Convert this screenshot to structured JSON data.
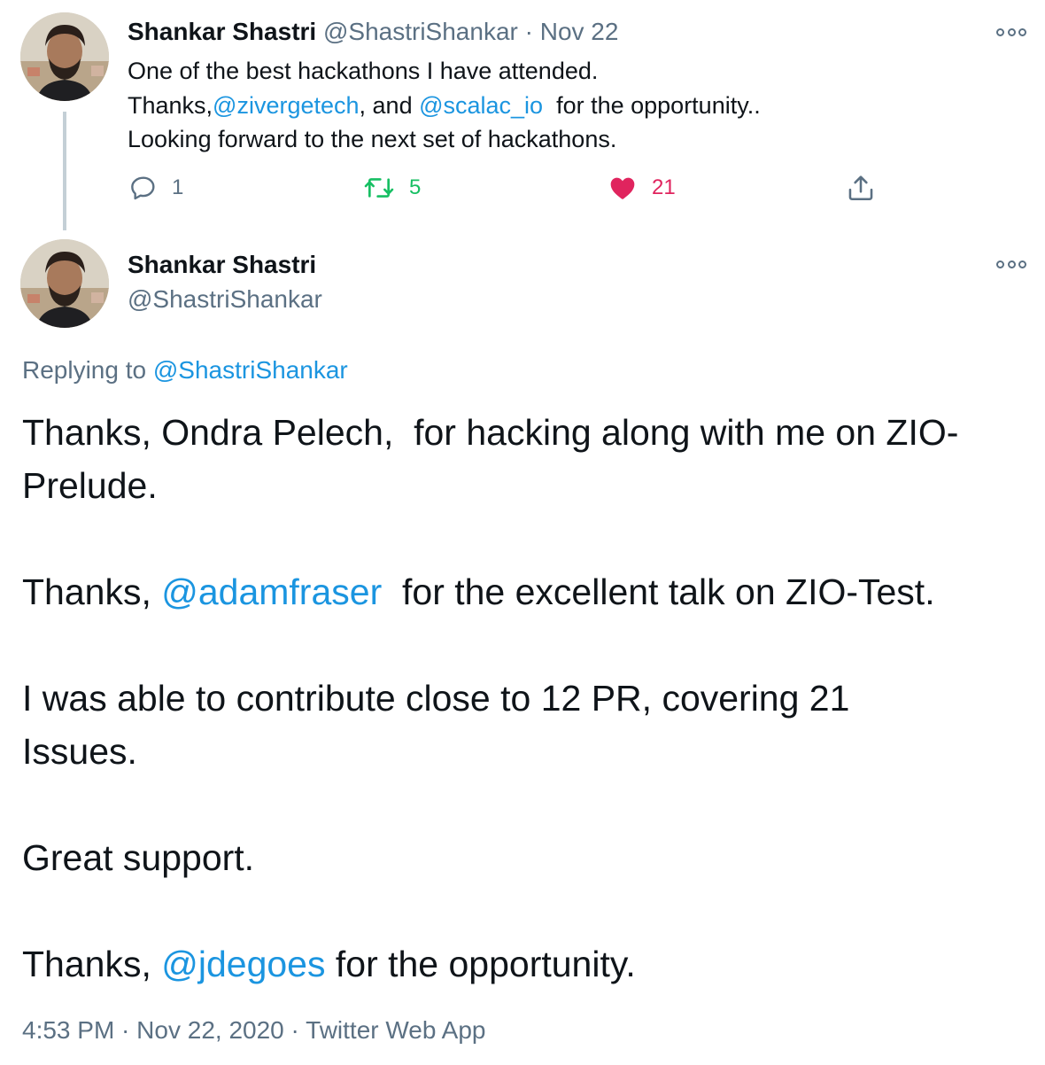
{
  "tweet1": {
    "author_name": "Shankar Shastri",
    "author_handle": "@ShastriShankar",
    "separator": "·",
    "date": "Nov 22",
    "more_icon": "more-options-icon",
    "body": {
      "line1": "One of the best hackathons I have attended.",
      "line2_prefix": "Thanks,",
      "mention_ziverge": "@zivergetech",
      "line2_mid": ", and ",
      "mention_scalac": "@scalac_io",
      "line2_suffix": "  for the opportunity..",
      "line3": "Looking forward to the next set of hackathons."
    },
    "actions": {
      "reply_count": "1",
      "retweet_count": "5",
      "like_count": "21"
    }
  },
  "tweet2": {
    "author_name": "Shankar Shastri",
    "author_handle": "@ShastriShankar",
    "replying_prefix": "Replying to ",
    "replying_handle": "@ShastriShankar",
    "body": {
      "p1_line1": "Thanks, Ondra Pelech,  for hacking along with me on ZIO-",
      "p1_line2": "Prelude.",
      "p2_prefix": "Thanks, ",
      "p2_mention": "@adamfraser",
      "p2_suffix": "  for the excellent talk on ZIO-Test.",
      "p3_line1": "I was able to contribute close to 12 PR, covering 21",
      "p3_line2": "Issues.",
      "p4": "Great support.",
      "p5_prefix": "Thanks, ",
      "p5_mention": "@jdegoes",
      "p5_suffix": " for the opportunity."
    },
    "meta": {
      "time": "4:53 PM",
      "sep1": " · ",
      "date": "Nov 22, 2020",
      "sep2": " · ",
      "source": "Twitter Web App"
    }
  },
  "colors": {
    "link": "#1b95e0",
    "muted": "#5b7083",
    "retweet": "#17bf63",
    "like": "#e0245e",
    "thread_line": "#c4cfd6"
  }
}
